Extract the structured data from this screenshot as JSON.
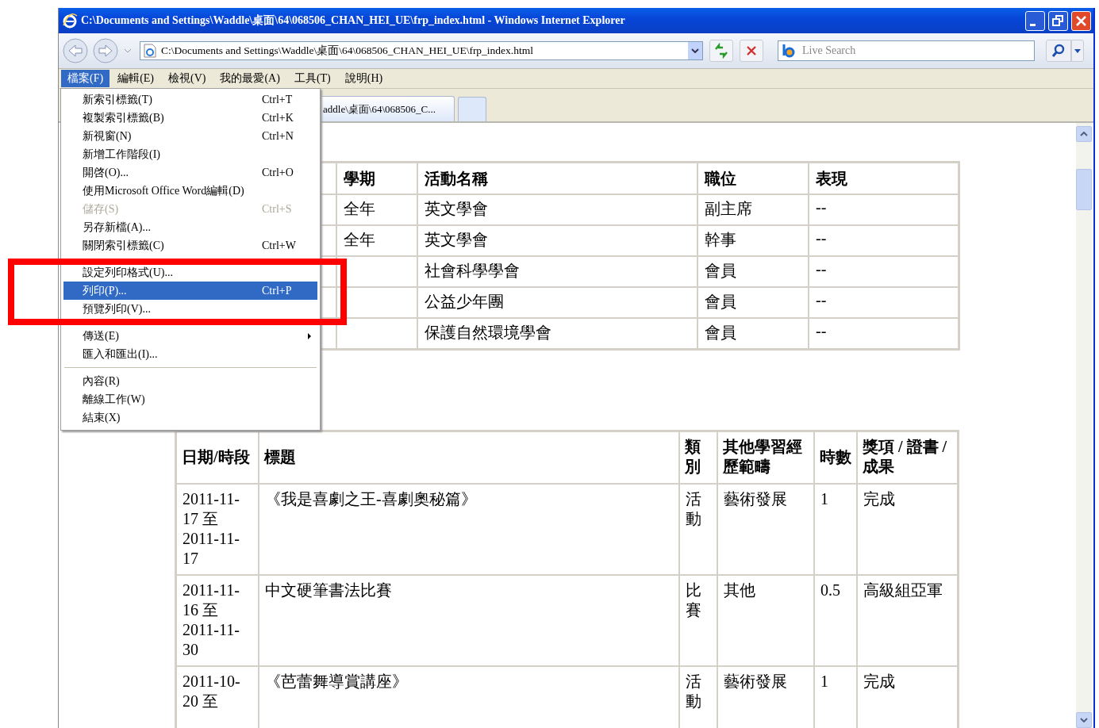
{
  "window": {
    "title": "C:\\Documents and Settings\\Waddle\\桌面\\64\\068506_CHAN_HEI_UE\\frp_index.html - Windows Internet Explorer"
  },
  "address_bar": {
    "value": "C:\\Documents and Settings\\Waddle\\桌面\\64\\068506_CHAN_HEI_UE\\frp_index.html"
  },
  "search": {
    "placeholder": "Live Search"
  },
  "menu_bar": [
    {
      "label": "檔案(F)",
      "selected": true
    },
    {
      "label": "編輯(E)",
      "selected": false
    },
    {
      "label": "檢視(V)",
      "selected": false
    },
    {
      "label": "我的最愛(A)",
      "selected": false
    },
    {
      "label": "工具(T)",
      "selected": false
    },
    {
      "label": "說明(H)",
      "selected": false
    }
  ],
  "tabs": [
    {
      "label": "addle\\桌面\\64\\068506_C..."
    }
  ],
  "file_menu": [
    {
      "kind": "item",
      "label": "新索引標籤(T)",
      "shortcut": "Ctrl+T",
      "disabled": false,
      "selected": false,
      "submenu": false
    },
    {
      "kind": "item",
      "label": "複製索引標籤(B)",
      "shortcut": "Ctrl+K",
      "disabled": false,
      "selected": false,
      "submenu": false
    },
    {
      "kind": "item",
      "label": "新視窗(N)",
      "shortcut": "Ctrl+N",
      "disabled": false,
      "selected": false,
      "submenu": false
    },
    {
      "kind": "item",
      "label": "新增工作階段(I)",
      "disabled": false,
      "selected": false,
      "submenu": false
    },
    {
      "kind": "item",
      "label": "開啓(O)...",
      "shortcut": "Ctrl+O",
      "disabled": false,
      "selected": false,
      "submenu": false
    },
    {
      "kind": "item",
      "label": "使用Microsoft Office Word編輯(D)",
      "disabled": false,
      "selected": false,
      "submenu": false
    },
    {
      "kind": "item",
      "label": "儲存(S)",
      "shortcut": "Ctrl+S",
      "disabled": true,
      "selected": false,
      "submenu": false
    },
    {
      "kind": "item",
      "label": "另存新檔(A)...",
      "disabled": false,
      "selected": false,
      "submenu": false
    },
    {
      "kind": "item",
      "label": "關閉索引標籤(C)",
      "shortcut": "Ctrl+W",
      "disabled": false,
      "selected": false,
      "submenu": false
    },
    {
      "kind": "separator"
    },
    {
      "kind": "item",
      "label": "設定列印格式(U)...",
      "disabled": false,
      "selected": false,
      "submenu": false
    },
    {
      "kind": "item",
      "label": "列印(P)...",
      "shortcut": "Ctrl+P",
      "disabled": false,
      "selected": true,
      "submenu": false
    },
    {
      "kind": "item",
      "label": "預覽列印(V)...",
      "disabled": false,
      "selected": false,
      "submenu": false
    },
    {
      "kind": "separator"
    },
    {
      "kind": "item",
      "label": "傳送(E)",
      "disabled": false,
      "selected": false,
      "submenu": true
    },
    {
      "kind": "item",
      "label": "匯入和匯出(I)...",
      "disabled": false,
      "selected": false,
      "submenu": false
    },
    {
      "kind": "separator"
    },
    {
      "kind": "item",
      "label": "內容(R)",
      "disabled": false,
      "selected": false,
      "submenu": false
    },
    {
      "kind": "item",
      "label": "離線工作(W)",
      "disabled": false,
      "selected": false,
      "submenu": false
    },
    {
      "kind": "item",
      "label": "結束(X)",
      "disabled": false,
      "selected": false,
      "submenu": false
    }
  ],
  "activities_table": {
    "columns": [
      "學期",
      "活動名稱",
      "職位",
      "表現"
    ],
    "rows": [
      [
        "全年",
        "英文學會",
        "副主席",
        "--"
      ],
      [
        "全年",
        "英文學會",
        "幹事",
        "--"
      ],
      [
        "",
        "社會科學學會",
        "會員",
        "--"
      ],
      [
        "",
        "公益少年團",
        "會員",
        "--"
      ],
      [
        "",
        "保護自然環境學會",
        "會員",
        "--"
      ]
    ]
  },
  "experiences_table": {
    "columns": [
      "日期/時段",
      "標題",
      "類別",
      "其他學習經歷範疇",
      "時數",
      "獎項 / 證書 / 成果"
    ],
    "rows": [
      [
        "2011-11-17 至 2011-11-17",
        "《我是喜劇之王-喜劇奧秘篇》",
        "活動",
        "藝術發展",
        "1",
        "完成"
      ],
      [
        "2011-11-16 至 2011-11-30",
        "中文硬筆書法比賽",
        "比賽",
        "其他",
        "0.5",
        "高級組亞軍"
      ],
      [
        "2011-10-20 至",
        "《芭蕾舞導賞講座》",
        "活動",
        "藝術發展",
        "1",
        "完成"
      ]
    ]
  }
}
